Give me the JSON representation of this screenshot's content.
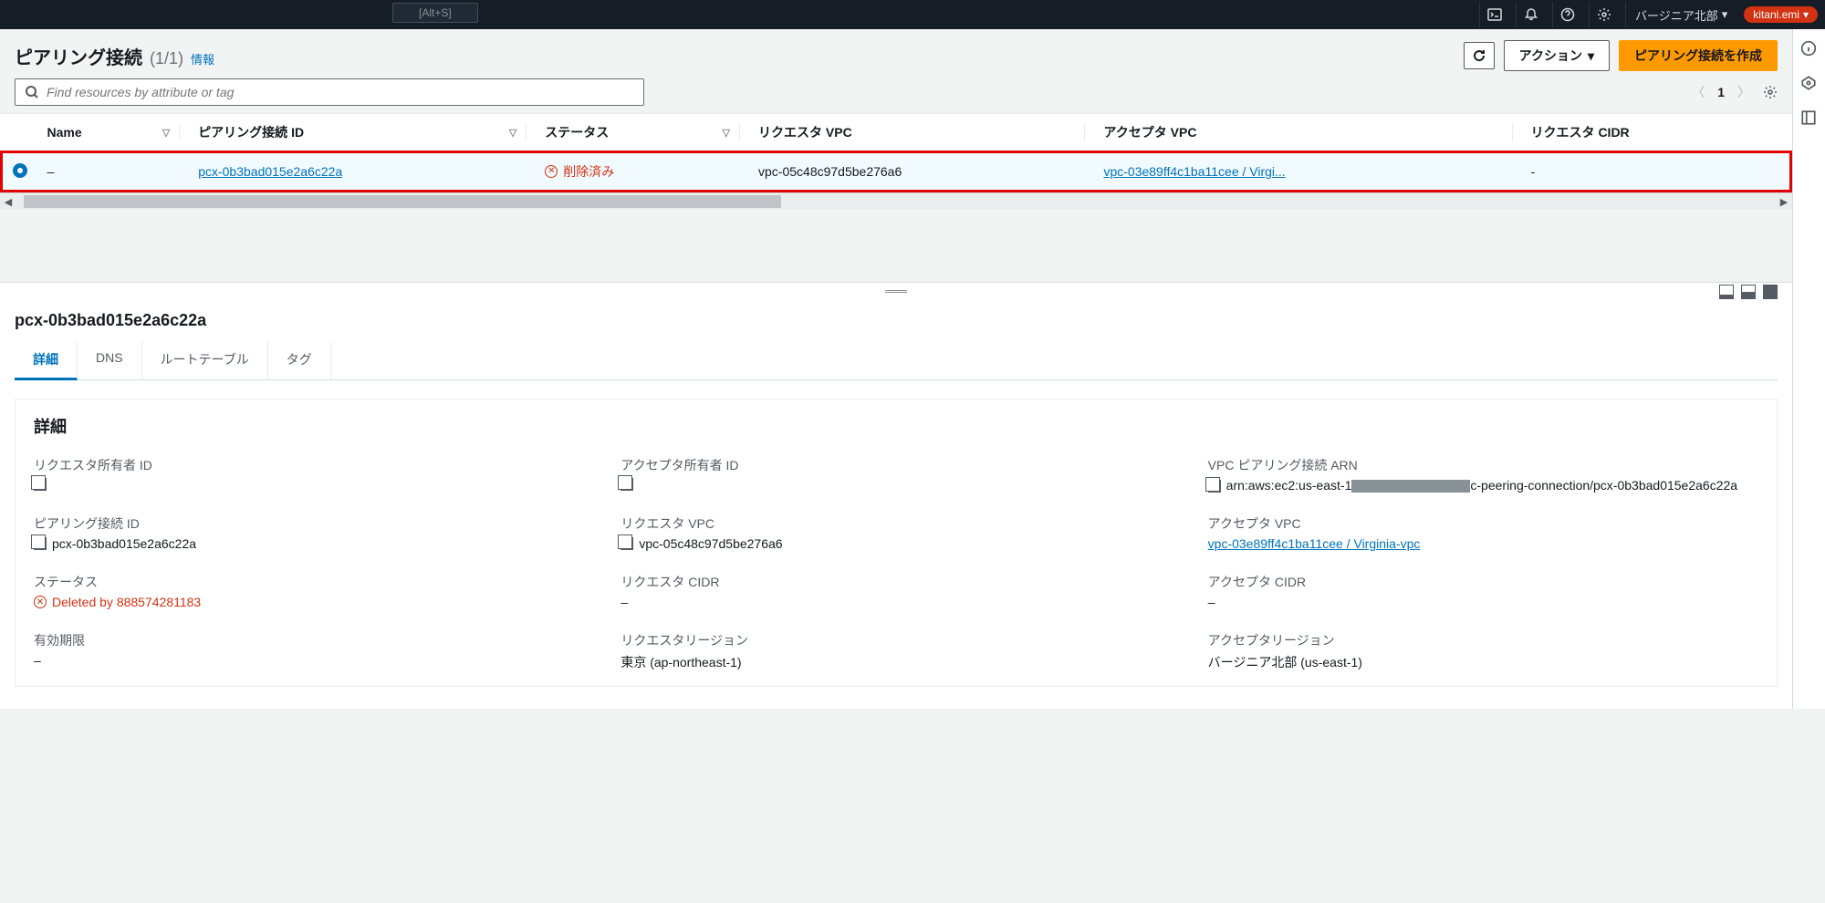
{
  "topbar": {
    "search_hint": "[Alt+S]",
    "region": "バージニア北部",
    "user": "kitani.emi"
  },
  "header": {
    "title": "ピアリング接続",
    "count": "(1/1)",
    "info": "情報",
    "actions_label": "アクション",
    "create_label": "ピアリング接続を作成"
  },
  "search": {
    "placeholder": "Find resources by attribute or tag"
  },
  "pager": {
    "page": "1"
  },
  "table": {
    "columns": {
      "name": "Name",
      "peering_id": "ピアリング接続 ID",
      "status": "ステータス",
      "requester_vpc": "リクエスタ VPC",
      "accepter_vpc": "アクセプタ VPC",
      "requester_cidr": "リクエスタ CIDR"
    },
    "row": {
      "name": "–",
      "peering_id": "pcx-0b3bad015e2a6c22a",
      "status": "削除済み",
      "requester_vpc": "vpc-05c48c97d5be276a6",
      "accepter_vpc": "vpc-03e89ff4c1ba11cee / Virgi...",
      "requester_cidr": "-"
    }
  },
  "detail": {
    "title": "pcx-0b3bad015e2a6c22a",
    "tabs": {
      "details": "詳細",
      "dns": "DNS",
      "route_tables": "ルートテーブル",
      "tags": "タグ"
    },
    "card_heading": "詳細",
    "fields": {
      "requester_owner_id": {
        "label": "リクエスタ所有者 ID"
      },
      "accepter_owner_id": {
        "label": "アクセプタ所有者 ID"
      },
      "arn": {
        "label": "VPC ピアリング接続 ARN",
        "value_prefix": "arn:aws:ec2:us-east-1",
        "value_suffix": "c-peering-connection/pcx-0b3bad015e2a6c22a"
      },
      "peering_id": {
        "label": "ピアリング接続 ID",
        "value": "pcx-0b3bad015e2a6c22a"
      },
      "requester_vpc": {
        "label": "リクエスタ VPC",
        "value": "vpc-05c48c97d5be276a6"
      },
      "accepter_vpc": {
        "label": "アクセプタ VPC",
        "value": "vpc-03e89ff4c1ba11cee / Virginia-vpc"
      },
      "status": {
        "label": "ステータス",
        "value": "Deleted by 888574281183"
      },
      "requester_cidr": {
        "label": "リクエスタ CIDR",
        "value": "–"
      },
      "accepter_cidr": {
        "label": "アクセプタ CIDR",
        "value": "–"
      },
      "expiration": {
        "label": "有効期限",
        "value": "–"
      },
      "requester_region": {
        "label": "リクエスタリージョン",
        "value": "東京 (ap-northeast-1)"
      },
      "accepter_region": {
        "label": "アクセプタリージョン",
        "value": "バージニア北部 (us-east-1)"
      }
    }
  }
}
